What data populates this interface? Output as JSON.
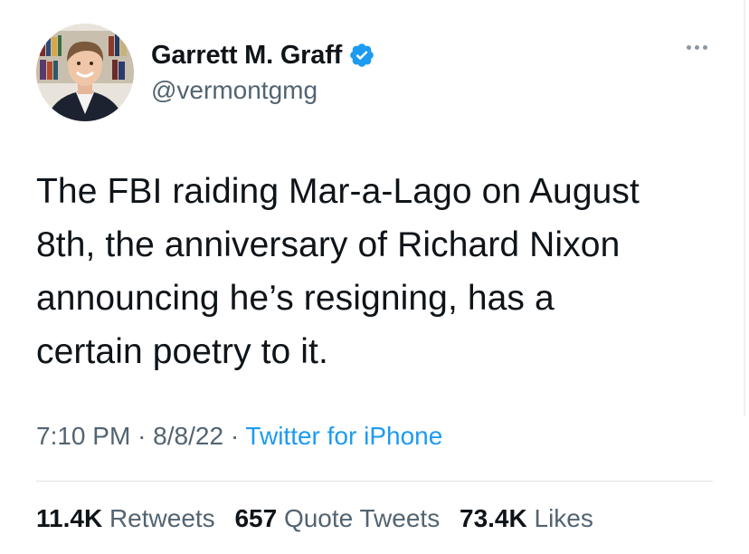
{
  "author": {
    "display_name": "Garrett M. Graff",
    "handle": "@vermontgmg",
    "verified": true,
    "avatar_icon": "user-avatar-photo"
  },
  "tweet": {
    "text": "The FBI raiding Mar-a-Lago on August\n8th, the anniversary of Richard Nixon\nannouncing he’s resigning, has a\ncertain poetry to it.",
    "time": "7:10 PM",
    "date": "8/8/22",
    "separator": "·",
    "source": "Twitter for iPhone"
  },
  "stats": {
    "retweets_count": "11.4K",
    "retweets_label": "Retweets",
    "quote_count": "657",
    "quote_label": "Quote Tweets",
    "likes_count": "73.4K",
    "likes_label": "Likes"
  },
  "colors": {
    "text": "#0f1419",
    "secondary": "#536471",
    "accent": "#1d9bf0"
  }
}
